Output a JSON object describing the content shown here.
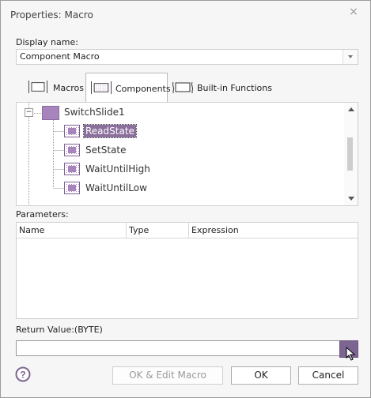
{
  "window": {
    "title": "Properties: Macro",
    "close_glyph": "×"
  },
  "display_name": {
    "label": "Display name:",
    "value": "Component Macro"
  },
  "tabs": [
    {
      "label": "Macros",
      "icon": "macro-icon"
    },
    {
      "label": "Components",
      "icon": "component-icon",
      "active": true
    },
    {
      "label": "Built-in Functions",
      "icon": "builtin-function-icon"
    }
  ],
  "tree": {
    "parent": {
      "label": "SwitchSlide1",
      "expander": "⊟"
    },
    "children": [
      {
        "label": "ReadState",
        "selected": true
      },
      {
        "label": "SetState"
      },
      {
        "label": "WaitUntilHigh"
      },
      {
        "label": "WaitUntilLow"
      }
    ]
  },
  "parameters": {
    "label": "Parameters:",
    "columns": [
      "Name",
      "Type",
      "Expression"
    ]
  },
  "return_value": {
    "label": "Return Value:(BYTE)",
    "value": ""
  },
  "buttons": {
    "ok_edit": "OK & Edit Macro",
    "ok": "OK",
    "cancel": "Cancel"
  },
  "colors": {
    "accent": "#7d6591",
    "selection": "#8b6f9c",
    "icon_fill": "#a884bd"
  }
}
